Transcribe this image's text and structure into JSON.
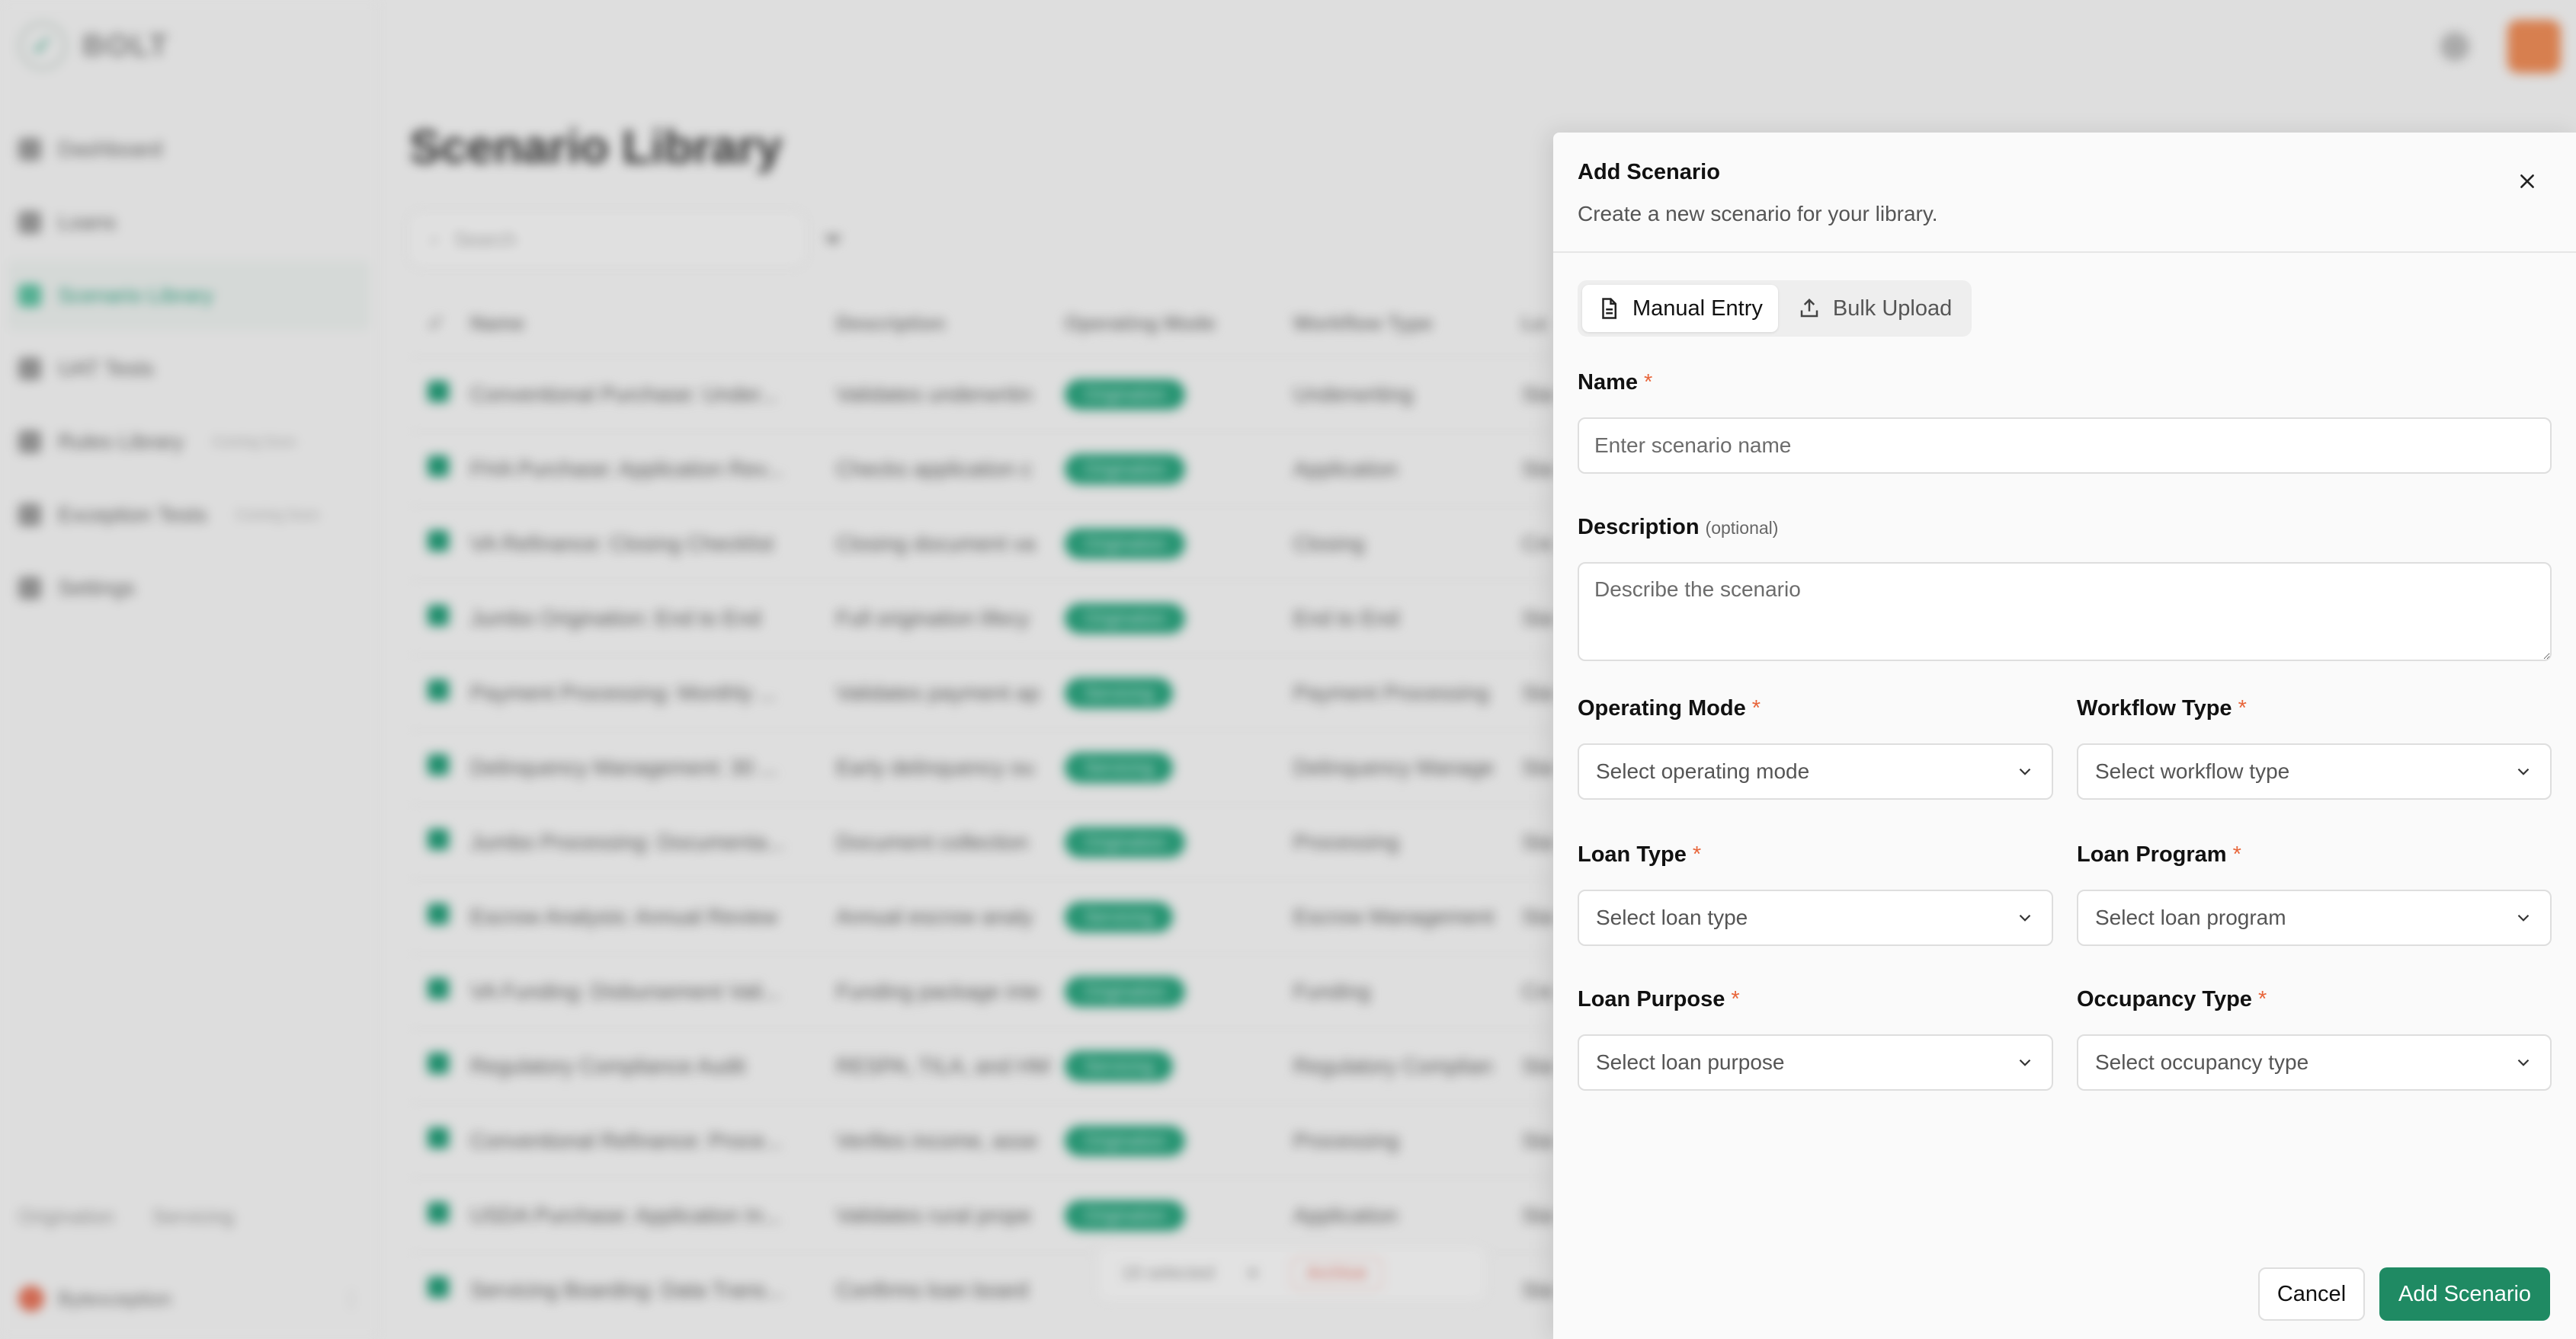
{
  "app": {
    "logo_text": "BOLT",
    "nav": [
      {
        "label": "Dashboard",
        "tag": ""
      },
      {
        "label": "Loans",
        "tag": ""
      },
      {
        "label": "Scenario Library",
        "tag": ""
      },
      {
        "label": "UAT Tests",
        "tag": ""
      },
      {
        "label": "Rules Library",
        "tag": "Coming Soon"
      },
      {
        "label": "Exception Tests",
        "tag": "Coming Soon"
      },
      {
        "label": "Settings",
        "tag": ""
      }
    ],
    "side_tabs": [
      "Origination",
      "Servicing"
    ],
    "user_name": "Bytexception",
    "page_title": "Scenario Library",
    "search_placeholder": "Search",
    "columns": [
      "Name",
      "Description",
      "Operating Mode",
      "Workflow Type",
      "Lo"
    ],
    "rows": [
      {
        "name": "Conventional Purchase: Under...",
        "desc": "Validates underwritin",
        "mode": "Origination",
        "workflow": "Underwriting",
        "lo": "Sta"
      },
      {
        "name": "FHA Purchase: Application Rev...",
        "desc": "Checks application c",
        "mode": "Origination",
        "workflow": "Application",
        "lo": "Sta"
      },
      {
        "name": "VA Refinance: Closing Checklist",
        "desc": "Closing document va",
        "mode": "Origination",
        "workflow": "Closing",
        "lo": "Cre"
      },
      {
        "name": "Jumbo Origination: End to End",
        "desc": "Full origination lifecy",
        "mode": "Origination",
        "workflow": "End to End",
        "lo": "Sta"
      },
      {
        "name": "Payment Processing: Monthly ...",
        "desc": "Validates payment ap",
        "mode": "Servicing",
        "workflow": "Payment Processing",
        "lo": "Sta"
      },
      {
        "name": "Delinquency Management: 30 ...",
        "desc": "Early delinquency ou",
        "mode": "Servicing",
        "workflow": "Delinquency Manage",
        "lo": "Sta"
      },
      {
        "name": "Jumbo Processing: Documenta...",
        "desc": "Document collection",
        "mode": "Origination",
        "workflow": "Processing",
        "lo": "Sta"
      },
      {
        "name": "Escrow Analysis: Annual Review",
        "desc": "Annual escrow analy",
        "mode": "Servicing",
        "workflow": "Escrow Management",
        "lo": "Sta"
      },
      {
        "name": "VA Funding: Disbursement Vali...",
        "desc": "Funding package inte",
        "mode": "Origination",
        "workflow": "Funding",
        "lo": "Cre"
      },
      {
        "name": "Regulatory Compliance Audit",
        "desc": "RESPA, TILA, and HM",
        "mode": "Servicing",
        "workflow": "Regulatory Complian",
        "lo": "Sta"
      },
      {
        "name": "Conventional Refinance: Proce...",
        "desc": "Verifies income, asse",
        "mode": "Origination",
        "workflow": "Processing",
        "lo": "Sta"
      },
      {
        "name": "USDA Purchase: Application In...",
        "desc": "Validates rural prope",
        "mode": "Origination",
        "workflow": "Application",
        "lo": "Sta"
      },
      {
        "name": "Servicing Boarding: Data Trans...",
        "desc": "Confirms loan board",
        "mode": "",
        "workflow": "",
        "lo": "Sta"
      }
    ],
    "bulk_bar": {
      "selected": "18 selected",
      "archive": "Archive"
    }
  },
  "drawer": {
    "title": "Add Scenario",
    "subtitle": "Create a new scenario for your library.",
    "tabs": {
      "manual": "Manual Entry",
      "bulk": "Bulk Upload"
    },
    "fields": {
      "name": {
        "label": "Name",
        "required": "*",
        "placeholder": "Enter scenario name"
      },
      "description": {
        "label": "Description",
        "optional": "(optional)",
        "placeholder": "Describe the scenario"
      },
      "operating_mode": {
        "label": "Operating Mode",
        "required": "*",
        "placeholder": "Select operating mode"
      },
      "workflow_type": {
        "label": "Workflow Type",
        "required": "*",
        "placeholder": "Select workflow type"
      },
      "loan_type": {
        "label": "Loan Type",
        "required": "*",
        "placeholder": "Select loan type"
      },
      "loan_program": {
        "label": "Loan Program",
        "required": "*",
        "placeholder": "Select loan program"
      },
      "loan_purpose": {
        "label": "Loan Purpose",
        "required": "*",
        "placeholder": "Select loan purpose"
      },
      "occupancy_type": {
        "label": "Occupancy Type",
        "required": "*",
        "placeholder": "Select occupancy type"
      }
    },
    "footer": {
      "cancel": "Cancel",
      "submit": "Add Scenario"
    }
  },
  "colors": {
    "accent": "#1f8a63",
    "required": "#e8663b",
    "pill": "#2aa17c"
  }
}
